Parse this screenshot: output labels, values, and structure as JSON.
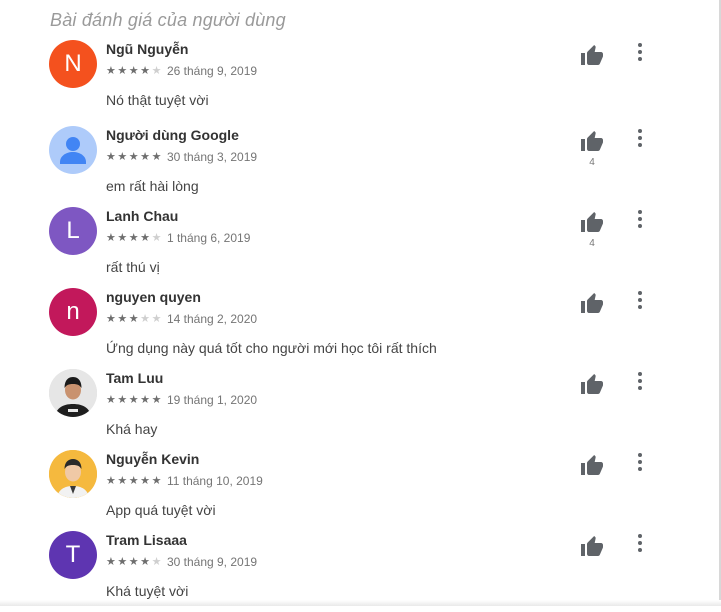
{
  "section": {
    "title": "Bài đánh giá của người dùng"
  },
  "colors": {
    "avatar_N": "#f4511e",
    "avatar_L": "#7e57c2",
    "avatar_n": "#c2185b",
    "avatar_T": "#5e35b1",
    "avatar_google": "#aecbfa",
    "star_on": "#6e6e6e",
    "star_off": "#cfcfcf"
  },
  "reviews": [
    {
      "name": "Ngũ Nguyễn",
      "rating": 4,
      "date": "26 tháng 9, 2019",
      "text": "Nó thật tuyệt vời",
      "avatar_letter": "N",
      "helpful": ""
    },
    {
      "name": "Người dùng Google",
      "rating": 5,
      "date": "30 tháng 3, 2019",
      "text": "em rất hài lòng",
      "avatar_letter": "",
      "helpful": "4"
    },
    {
      "name": "Lanh Chau",
      "rating": 4,
      "date": "1 tháng 6, 2019",
      "text": "rất thú vị",
      "avatar_letter": "L",
      "helpful": "4"
    },
    {
      "name": "nguyen quyen",
      "rating": 3,
      "date": "14 tháng 2, 2020",
      "text": "Ứng dụng này quá tốt cho người mới học tôi rất thích",
      "avatar_letter": "n",
      "helpful": ""
    },
    {
      "name": "Tam Luu",
      "rating": 5,
      "date": "19 tháng 1, 2020",
      "text": "Khá hay",
      "avatar_letter": "",
      "helpful": ""
    },
    {
      "name": "Nguyễn Kevin",
      "rating": 5,
      "date": "11 tháng 10, 2019",
      "text": "App quá tuyệt vời",
      "avatar_letter": "",
      "helpful": ""
    },
    {
      "name": "Tram Lisaaa",
      "rating": 4,
      "date": "30 tháng 9, 2019",
      "text": "Khá tuyệt vời",
      "avatar_letter": "T",
      "helpful": ""
    }
  ],
  "icons": {
    "helpful": "thumb-up-icon",
    "menu": "more-vert-icon",
    "star": "star-icon"
  }
}
